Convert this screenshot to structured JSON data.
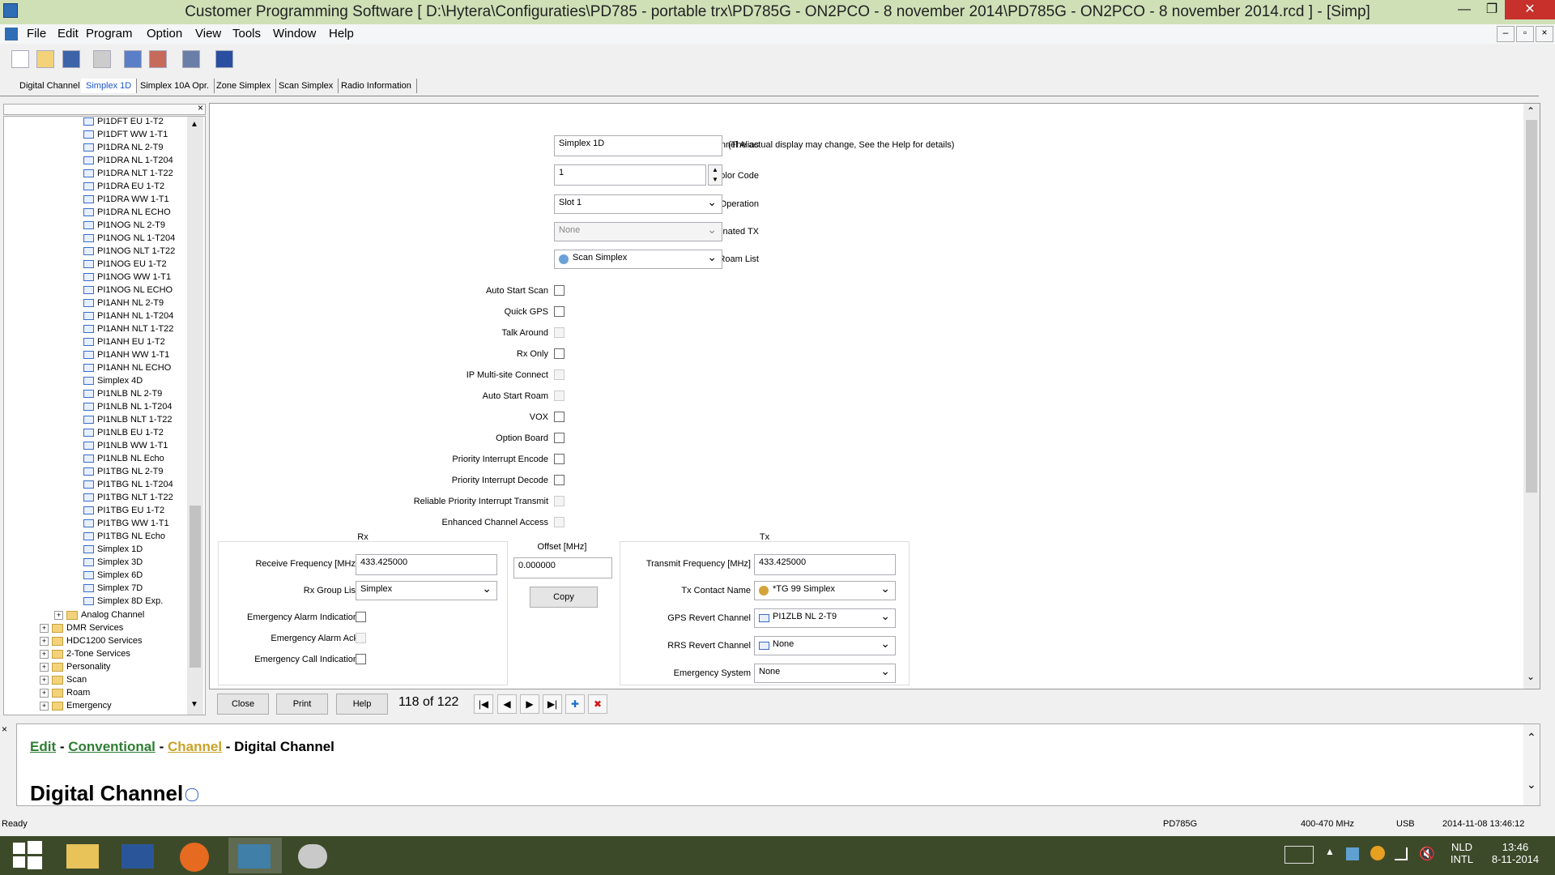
{
  "window": {
    "title": "Customer Programming Software [ D:\\Hytera\\Configuraties\\PD785 - portable trx\\PD785G - ON2PCO - 8 november 2014\\PD785G - ON2PCO - 8 november 2014.rcd ] - [Simp]",
    "min_label": "—",
    "max_label": "❐",
    "close_label": "✕",
    "mdi_min_label": "–",
    "mdi_restore_label": "▫",
    "mdi_close_label": "×"
  },
  "menu": [
    "File",
    "Edit",
    "Program",
    "Option",
    "View",
    "Tools",
    "Window",
    "Help"
  ],
  "tabs": [
    "Digital Channel",
    "Simplex 1D",
    "Simplex 10A Opr.",
    "Zone Simplex",
    "Scan Simplex",
    "Radio Information"
  ],
  "tree": {
    "pane_close": "×",
    "channels": [
      "PI1DFT EU 1-T2",
      "PI1DFT WW 1-T1",
      "PI1DRA NL 2-T9",
      "PI1DRA NL 1-T204",
      "PI1DRA NLT 1-T22",
      "PI1DRA EU 1-T2",
      "PI1DRA WW 1-T1",
      "PI1DRA NL ECHO",
      "PI1NOG NL 2-T9",
      "PI1NOG NL 1-T204",
      "PI1NOG NLT 1-T22",
      "PI1NOG EU 1-T2",
      "PI1NOG WW 1-T1",
      "PI1NOG NL ECHO",
      "PI1ANH NL 2-T9",
      "PI1ANH NL 1-T204",
      "PI1ANH NLT 1-T22",
      "PI1ANH EU 1-T2",
      "PI1ANH WW 1-T1",
      "PI1ANH NL ECHO",
      "Simplex 4D",
      "PI1NLB NL 2-T9",
      "PI1NLB NL 1-T204",
      "PI1NLB NLT 1-T22",
      "PI1NLB EU 1-T2",
      "PI1NLB WW 1-T1",
      "PI1NLB NL Echo",
      "PI1TBG NL 2-T9",
      "PI1TBG NL 1-T204",
      "PI1TBG NLT 1-T22",
      "PI1TBG EU 1-T2",
      "PI1TBG WW 1-T1",
      "PI1TBG NL Echo",
      "Simplex 1D",
      "Simplex 3D",
      "Simplex 6D",
      "Simplex 7D",
      "Simplex 8D Exp."
    ],
    "analog": "Analog Channel",
    "folders": [
      "DMR Services",
      "HDC1200 Services",
      "2-Tone Services",
      "Personality",
      "Scan",
      "Roam",
      "Emergency"
    ]
  },
  "form": {
    "channel_alias_label": "Channel Alias",
    "channel_alias": "Simplex 1D",
    "alias_note": "(The actual display may change, See the Help for details)",
    "color_code_label": "Color Code",
    "color_code": "1",
    "slot_operation_label": "Slot Operation",
    "slot_operation": "Slot 1",
    "pseudo_trunk_label": "Pseudo Trunk Designated TX",
    "pseudo_trunk": "None",
    "scan_list_label": "Scan List/Roam List",
    "scan_list": "Scan Simplex",
    "checks": [
      {
        "label": "Auto Start Scan",
        "enabled": true
      },
      {
        "label": "Quick GPS",
        "enabled": true
      },
      {
        "label": "Talk Around",
        "enabled": false
      },
      {
        "label": "Rx Only",
        "enabled": true
      },
      {
        "label": "IP Multi-site Connect",
        "enabled": false
      },
      {
        "label": "Auto Start Roam",
        "enabled": false
      },
      {
        "label": "VOX",
        "enabled": true
      },
      {
        "label": "Option Board",
        "enabled": true
      },
      {
        "label": "Priority Interrupt Encode",
        "enabled": true
      },
      {
        "label": "Priority Interrupt Decode",
        "enabled": true
      },
      {
        "label": "Reliable Priority Interrupt Transmit",
        "enabled": false
      },
      {
        "label": "Enhanced Channel Access",
        "enabled": false
      }
    ],
    "rx": {
      "title": "Rx",
      "freq_label": "Receive Frequency [MHz]",
      "freq": "433.425000",
      "group_label": "Rx Group List",
      "group": "Simplex",
      "alarm_ind_label": "Emergency Alarm Indication",
      "alarm_ack_label": "Emergency Alarm Ack",
      "call_ind_label": "Emergency Call Indication"
    },
    "offset": {
      "title": "Offset [MHz]",
      "value": "0.000000",
      "copy": "Copy"
    },
    "tx": {
      "title": "Tx",
      "freq_label": "Transmit Frequency [MHz]",
      "freq": "433.425000",
      "contact_label": "Tx Contact Name",
      "contact": "*TG 99 Simplex",
      "gps_label": "GPS Revert Channel",
      "gps": "PI1ZLB NL 2-T9",
      "rrs_label": "RRS Revert Channel",
      "rrs": "None",
      "emerg_label": "Emergency System",
      "emerg": "None"
    }
  },
  "bottom": {
    "close": "Close",
    "print": "Print",
    "help": "Help",
    "record": "118 of 122",
    "nav": [
      "|◀",
      "◀",
      "▶",
      "▶|",
      "✚",
      "✖"
    ]
  },
  "help": {
    "crumbs": [
      "Edit",
      "Conventional",
      "Channel"
    ],
    "sep": " - ",
    "current": "Digital Channel",
    "heading": "Digital Channel"
  },
  "status": {
    "left": "Ready",
    "model": "PD785G",
    "band": "400-470 MHz",
    "port": "USB",
    "datetime": "2014-11-08 13:46:12"
  },
  "taskbar": {
    "lang1": "NLD",
    "lang2": "INTL",
    "time": "13:46",
    "date": "8-11-2014"
  },
  "colors": {
    "titlebar": "#cfe0b7",
    "link": "#2e7d32",
    "link_current": "#c9a227",
    "taskbar": "#3d4a2a"
  }
}
